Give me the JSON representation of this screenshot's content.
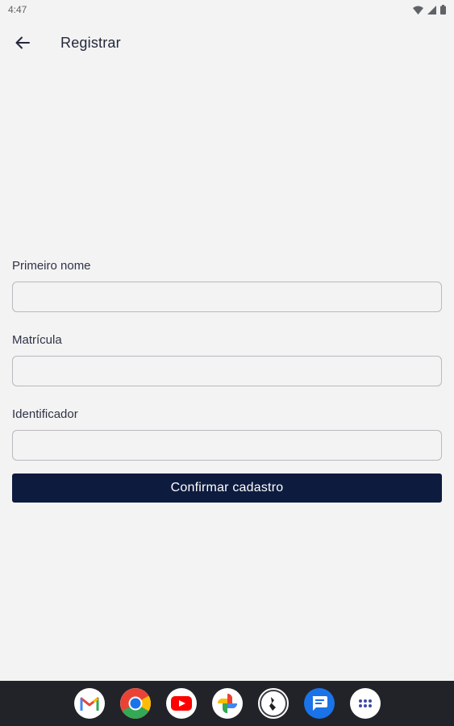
{
  "status_bar": {
    "time": "4:47"
  },
  "app_bar": {
    "title": "Registrar",
    "back_icon": "arrow-back-icon"
  },
  "form": {
    "first_name": {
      "label": "Primeiro nome",
      "value": "",
      "placeholder": ""
    },
    "registration": {
      "label": "Matrícula",
      "value": "",
      "placeholder": ""
    },
    "identifier": {
      "label": "Identificador",
      "value": "",
      "placeholder": ""
    },
    "confirm_label": "Confirmar cadastro"
  },
  "dock": {
    "apps": [
      "gmail-icon",
      "chrome-icon",
      "youtube-icon",
      "photos-icon",
      "app-icon",
      "messages-icon",
      "app-drawer-icon"
    ]
  },
  "colors": {
    "background": "#f3f3f3",
    "primary_button": "#0d1b3e",
    "nav_bar": "#222328"
  }
}
